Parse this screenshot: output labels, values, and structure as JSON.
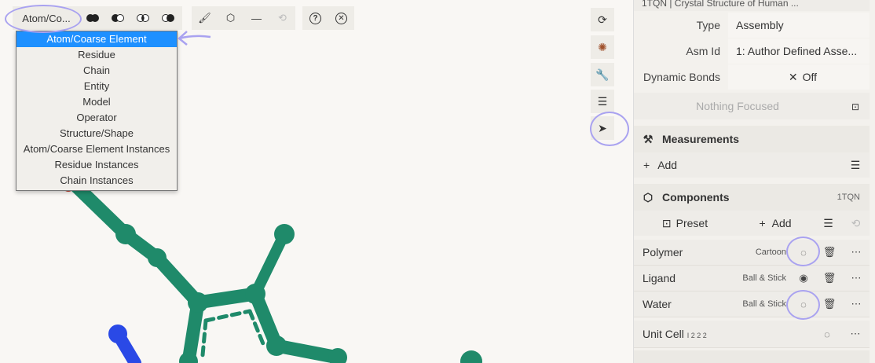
{
  "toolbar": {
    "granularity_value": "Atom/Co...",
    "buttons": [
      {
        "icon": "select-all-icon"
      },
      {
        "icon": "add-selection-icon"
      },
      {
        "icon": "intersect-selection-icon"
      },
      {
        "icon": "subtract-selection-icon"
      },
      {
        "icon": "paint-icon"
      },
      {
        "icon": "cube-icon"
      },
      {
        "icon": "minus-icon"
      },
      {
        "icon": "undo-history-icon"
      },
      {
        "icon": "help-icon"
      },
      {
        "icon": "close-circle-icon"
      }
    ]
  },
  "granularity_options": [
    "Atom/Coarse Element",
    "Residue",
    "Chain",
    "Entity",
    "Model",
    "Operator",
    "Structure/Shape",
    "Atom/Coarse Element Instances",
    "Residue Instances",
    "Chain Instances"
  ],
  "selected_option": "Atom/Coarse Element",
  "side_icons": [
    "reset-camera-icon",
    "screenshot-icon",
    "wrench-icon",
    "sliders-icon",
    "cursor-icon"
  ],
  "panel": {
    "structure_title": "1TQN | Crystal Structure of Human ...",
    "type_label": "Type",
    "type_value": "Assembly",
    "asm_label": "Asm Id",
    "asm_value": "1: Author Defined Asse...",
    "bonds_label": "Dynamic Bonds",
    "bonds_value": "Off",
    "focus_text": "Nothing Focused",
    "measurements_title": "Measurements",
    "add_label": "Add",
    "components_title": "Components",
    "components_id": "1TQN",
    "preset_label": "Preset",
    "components_add_label": "Add",
    "components": [
      {
        "name": "Polymer",
        "repr": "Cartoon"
      },
      {
        "name": "Ligand",
        "repr": "Ball & Stick"
      },
      {
        "name": "Water",
        "repr": "Ball & Stick"
      }
    ],
    "unit_cell_name": "Unit Cell",
    "unit_cell_sg": "I 2 2 2"
  },
  "colors": {
    "molecule": "#1f8a6a",
    "nitrogen": "#2a49e6",
    "oxygen": "#c0392b",
    "annotation": "#a9a2f0",
    "highlight": "#1e90ff"
  }
}
